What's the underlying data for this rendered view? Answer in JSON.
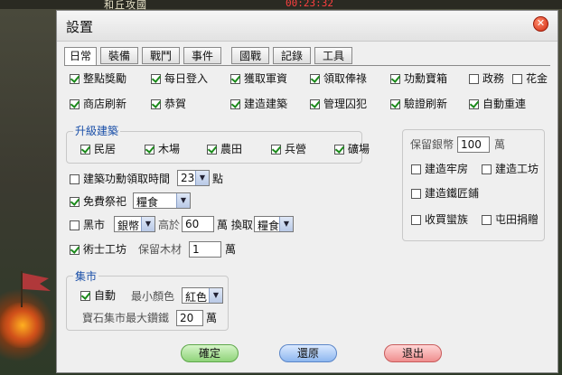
{
  "game": {
    "title": "和丘攻國",
    "timer": "00:23:32"
  },
  "dialog": {
    "title": "設置",
    "close_label": "✕"
  },
  "tabs": [
    "日常",
    "裝備",
    "戰鬥",
    "事件",
    "國戰",
    "記錄",
    "工具"
  ],
  "row1": [
    {
      "label": "整點獎勵",
      "checked": true
    },
    {
      "label": "每日登入",
      "checked": true
    },
    {
      "label": "獲取軍資",
      "checked": true
    },
    {
      "label": "領取俸祿",
      "checked": true
    },
    {
      "label": "功勳寶箱",
      "checked": true
    },
    {
      "label": "政務",
      "checked": false
    },
    {
      "label": "花金",
      "checked": false
    }
  ],
  "row2": [
    {
      "label": "商店刷新",
      "checked": true
    },
    {
      "label": "恭賀",
      "checked": true
    },
    {
      "label": "建造建築",
      "checked": true
    },
    {
      "label": "管理囚犯",
      "checked": true
    },
    {
      "label": "驗證刷新",
      "checked": true
    },
    {
      "label": "自動重連",
      "checked": true
    }
  ],
  "upgrade": {
    "legend": "升級建築",
    "items": [
      {
        "label": "民居",
        "checked": true
      },
      {
        "label": "木場",
        "checked": true
      },
      {
        "label": "農田",
        "checked": true
      },
      {
        "label": "兵營",
        "checked": true
      },
      {
        "label": "礦場",
        "checked": true
      }
    ]
  },
  "build_reward": {
    "label": "建築功勳領取時間",
    "checked": false,
    "value": "23",
    "unit": "點"
  },
  "sacrifice": {
    "label": "免費祭祀",
    "checked": true,
    "value": "糧食"
  },
  "black_market": {
    "label": "黑市",
    "checked": false,
    "item": "銀幣",
    "above_label": "高於",
    "above_value": "60",
    "exchange_label": "萬 換取",
    "target": "糧食"
  },
  "workshop": {
    "label": "術士工坊",
    "checked": true,
    "keep_label": "保留木材",
    "value": "1",
    "unit": "萬"
  },
  "market": {
    "legend": "集市",
    "auto_label": "自動",
    "auto_checked": true,
    "min_color_label": "最小顏色",
    "min_color_value": "紅色",
    "gem_label": "寶石集市最大鑽鐵",
    "gem_value": "20",
    "gem_unit": "萬"
  },
  "right_panel": {
    "keep_silver_label": "保留銀幣",
    "keep_silver_value": "100",
    "keep_silver_unit": "萬",
    "items": [
      {
        "label": "建造牢房",
        "checked": false
      },
      {
        "label": "建造工坊",
        "checked": false
      },
      {
        "label": "建造鐵匠鋪",
        "checked": false
      },
      {
        "label": "收買蠻族",
        "checked": false
      },
      {
        "label": "屯田捐贈",
        "checked": false
      }
    ]
  },
  "buttons": {
    "confirm": "確定",
    "restore": "還原",
    "exit": "退出"
  }
}
